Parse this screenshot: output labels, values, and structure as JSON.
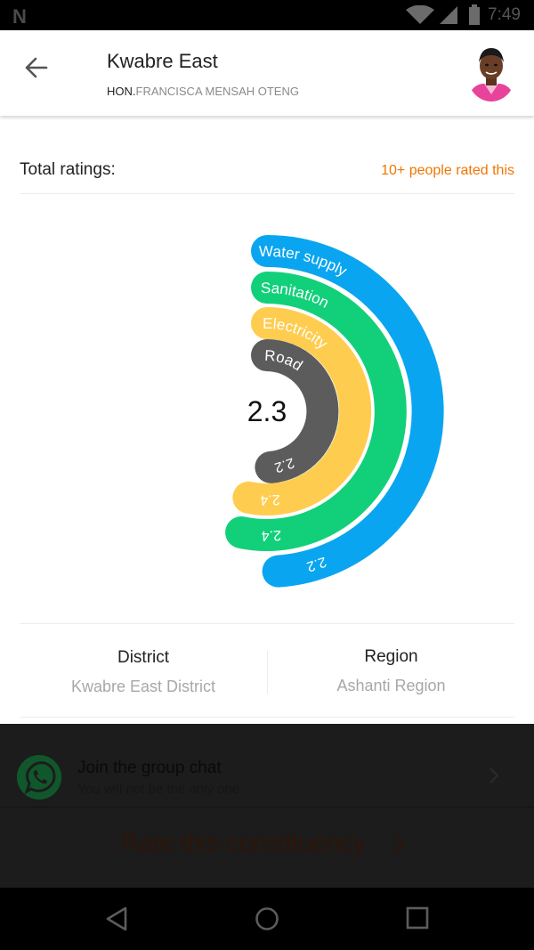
{
  "status_bar": {
    "time": "7:49",
    "icons": [
      "notification-n-icon",
      "wifi-icon",
      "cell-signal-icon",
      "battery-icon"
    ]
  },
  "header": {
    "title": "Kwabre East",
    "subtitle_prefix": "HON.",
    "subtitle_name": "FRANCISCA MENSAH OTENG",
    "back_icon": "arrow-left-icon",
    "avatar_icon": "representative-avatar"
  },
  "ratings": {
    "label": "Total ratings:",
    "count_text": "10+ people rated this"
  },
  "chart_data": {
    "type": "radial-bar",
    "center_value": "2.3",
    "categories": [
      "Water supply",
      "Sanitation",
      "Electricity",
      "Road"
    ],
    "values": [
      2.2,
      2.4,
      2.4,
      2.2
    ],
    "value_labels": [
      "2.2",
      "2.4",
      "2.4",
      "2.2"
    ],
    "colors": [
      "#0aa5f0",
      "#12d07a",
      "#fecd50",
      "#5c5c5c"
    ]
  },
  "info": {
    "district_title": "District",
    "district_value": "Kwabre East District",
    "region_title": "Region",
    "region_value": "Ashanti Region"
  },
  "chat": {
    "title": "Join the group chat",
    "subtitle": "You will not be the only one",
    "icon": "whatsapp-icon",
    "chevron_icon": "chevron-right-icon"
  },
  "rate": {
    "label": "Rate this constituency",
    "chevron_icon": "chevron-right-icon"
  },
  "nav": {
    "icons": [
      "back-triangle-icon",
      "home-circle-icon",
      "recents-square-icon"
    ]
  }
}
